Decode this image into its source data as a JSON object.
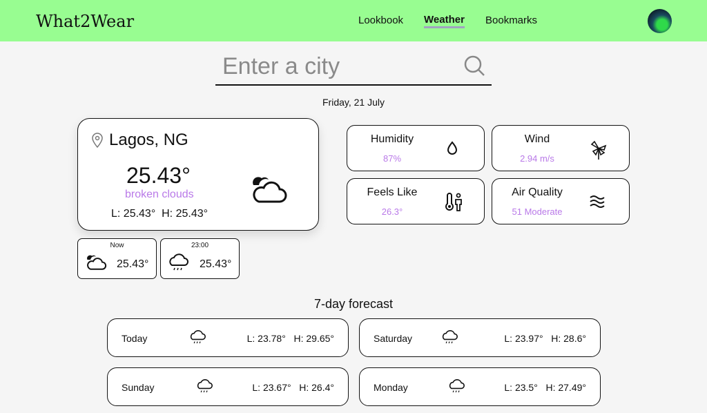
{
  "header": {
    "logo": "What2Wear",
    "nav": [
      "Lookbook",
      "Weather",
      "Bookmarks"
    ]
  },
  "search": {
    "placeholder": "Enter a city"
  },
  "date": "Friday, 21 July",
  "current": {
    "city": "Lagos, NG",
    "temp": "25.43°",
    "description": "broken clouds",
    "low": "L: 25.43°",
    "high": "H: 25.43°"
  },
  "hourly": [
    {
      "time": "Now",
      "temp": "25.43°",
      "icon": "cloudy-icon"
    },
    {
      "time": "23:00",
      "temp": "25.43°",
      "icon": "rain-icon"
    }
  ],
  "stats": [
    {
      "label": "Humidity",
      "value": "87%"
    },
    {
      "label": "Wind",
      "value": "2.94 m/s"
    },
    {
      "label": "Feels Like",
      "value": "26.3°"
    },
    {
      "label": "Air Quality",
      "value": "51 Moderate"
    }
  ],
  "forecast": {
    "title": "7-day forecast",
    "days": [
      {
        "day": "Today",
        "range": "L: 23.78°   H: 29.65°"
      },
      {
        "day": "Saturday",
        "range": "L: 23.97°   H: 28.6°"
      },
      {
        "day": "Sunday",
        "range": "L: 23.67°   H: 26.4°"
      },
      {
        "day": "Monday",
        "range": "L: 23.5°   H: 27.49°"
      }
    ]
  },
  "colors": {
    "header": "#98fd91",
    "accent": "#b979e8"
  }
}
